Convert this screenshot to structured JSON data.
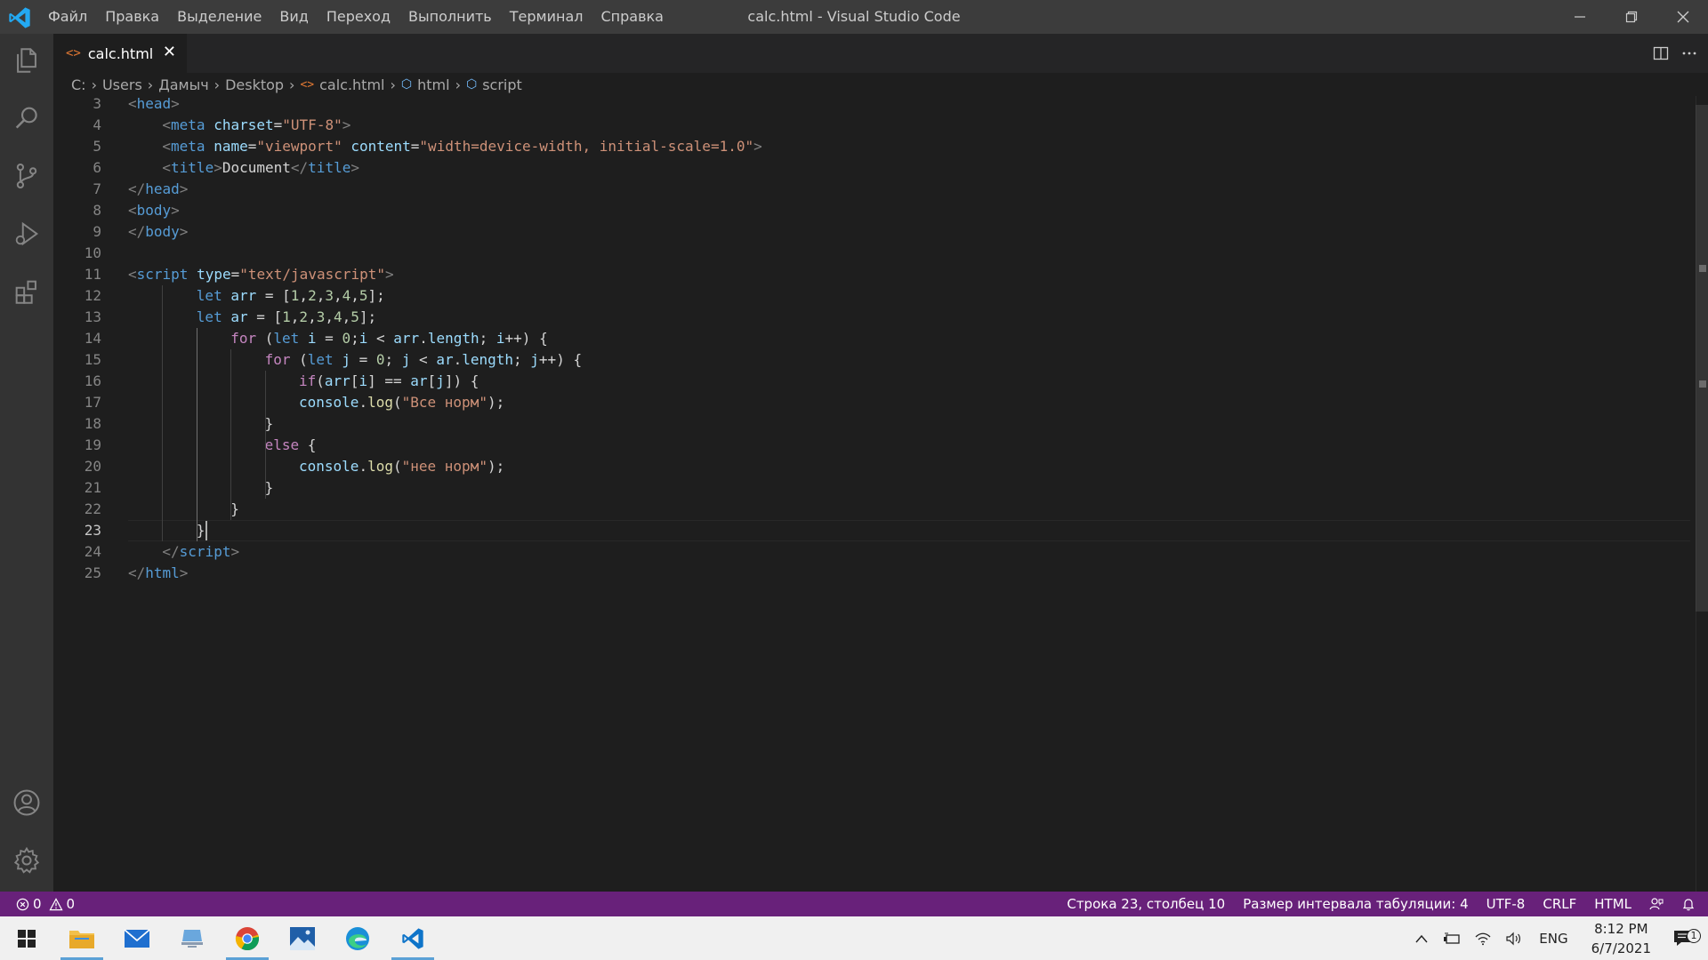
{
  "window": {
    "title": "calc.html - Visual Studio Code",
    "menu": [
      "Файл",
      "Правка",
      "Выделение",
      "Вид",
      "Переход",
      "Выполнить",
      "Терминал",
      "Справка"
    ]
  },
  "tab": {
    "icon": "<>",
    "label": "calc.html",
    "close": "✕"
  },
  "breadcrumb": {
    "parts": [
      "C:",
      "Users",
      "Дамыч",
      "Desktop"
    ],
    "file": "calc.html",
    "symbols": [
      "html",
      "script"
    ]
  },
  "editor": {
    "active_line": 23,
    "lines": [
      {
        "n": "3",
        "indent": 0,
        "tokens": [
          [
            "br",
            "<"
          ],
          [
            "tag",
            "head"
          ],
          [
            "br",
            ">"
          ]
        ]
      },
      {
        "n": "4",
        "indent": 1,
        "tokens": [
          [
            "br",
            "<"
          ],
          [
            "tag",
            "meta"
          ],
          [
            "txt",
            " "
          ],
          [
            "attr",
            "charset"
          ],
          [
            "txt",
            "="
          ],
          [
            "str",
            "\"UTF-8\""
          ],
          [
            "br",
            ">"
          ]
        ]
      },
      {
        "n": "5",
        "indent": 1,
        "tokens": [
          [
            "br",
            "<"
          ],
          [
            "tag",
            "meta"
          ],
          [
            "txt",
            " "
          ],
          [
            "attr",
            "name"
          ],
          [
            "txt",
            "="
          ],
          [
            "str",
            "\"viewport\""
          ],
          [
            "txt",
            " "
          ],
          [
            "attr",
            "content"
          ],
          [
            "txt",
            "="
          ],
          [
            "str",
            "\"width=device-width, initial-scale=1.0\""
          ],
          [
            "br",
            ">"
          ]
        ]
      },
      {
        "n": "6",
        "indent": 1,
        "tokens": [
          [
            "br",
            "<"
          ],
          [
            "tag",
            "title"
          ],
          [
            "br",
            ">"
          ],
          [
            "txt",
            "Document"
          ],
          [
            "br",
            "</"
          ],
          [
            "tag",
            "title"
          ],
          [
            "br",
            ">"
          ]
        ]
      },
      {
        "n": "7",
        "indent": 0,
        "tokens": [
          [
            "br",
            "</"
          ],
          [
            "tag",
            "head"
          ],
          [
            "br",
            ">"
          ]
        ]
      },
      {
        "n": "8",
        "indent": 0,
        "tokens": [
          [
            "br",
            "<"
          ],
          [
            "tag",
            "body"
          ],
          [
            "br",
            ">"
          ]
        ]
      },
      {
        "n": "9",
        "indent": 0,
        "tokens": [
          [
            "br",
            "</"
          ],
          [
            "tag",
            "body"
          ],
          [
            "br",
            ">"
          ]
        ]
      },
      {
        "n": "10",
        "indent": 0,
        "tokens": []
      },
      {
        "n": "11",
        "indent": 0,
        "tokens": [
          [
            "br",
            "<"
          ],
          [
            "tag",
            "script"
          ],
          [
            "txt",
            " "
          ],
          [
            "attr",
            "type"
          ],
          [
            "txt",
            "="
          ],
          [
            "str",
            "\"text/javascript\""
          ],
          [
            "br",
            ">"
          ]
        ]
      },
      {
        "n": "12",
        "indent": 2,
        "tokens": [
          [
            "kw",
            "let"
          ],
          [
            "txt",
            " "
          ],
          [
            "var",
            "arr"
          ],
          [
            "txt",
            " = ["
          ],
          [
            "num",
            "1"
          ],
          [
            "txt",
            ","
          ],
          [
            "num",
            "2"
          ],
          [
            "txt",
            ","
          ],
          [
            "num",
            "3"
          ],
          [
            "txt",
            ","
          ],
          [
            "num",
            "4"
          ],
          [
            "txt",
            ","
          ],
          [
            "num",
            "5"
          ],
          [
            "txt",
            "];"
          ]
        ]
      },
      {
        "n": "13",
        "indent": 2,
        "tokens": [
          [
            "kw",
            "let"
          ],
          [
            "txt",
            " "
          ],
          [
            "var",
            "ar"
          ],
          [
            "txt",
            " = ["
          ],
          [
            "num",
            "1"
          ],
          [
            "txt",
            ","
          ],
          [
            "num",
            "2"
          ],
          [
            "txt",
            ","
          ],
          [
            "num",
            "3"
          ],
          [
            "txt",
            ","
          ],
          [
            "num",
            "4"
          ],
          [
            "txt",
            ","
          ],
          [
            "num",
            "5"
          ],
          [
            "txt",
            "];"
          ]
        ]
      },
      {
        "n": "14",
        "indent": 3,
        "tokens": [
          [
            "ctl",
            "for"
          ],
          [
            "txt",
            " ("
          ],
          [
            "kw",
            "let"
          ],
          [
            "txt",
            " "
          ],
          [
            "var",
            "i"
          ],
          [
            "txt",
            " = "
          ],
          [
            "num",
            "0"
          ],
          [
            "txt",
            ";"
          ],
          [
            "var",
            "i"
          ],
          [
            "txt",
            " < "
          ],
          [
            "var",
            "arr"
          ],
          [
            "txt",
            "."
          ],
          [
            "var",
            "length"
          ],
          [
            "txt",
            "; "
          ],
          [
            "var",
            "i"
          ],
          [
            "txt",
            "++) {"
          ]
        ]
      },
      {
        "n": "15",
        "indent": 4,
        "tokens": [
          [
            "ctl",
            "for"
          ],
          [
            "txt",
            " ("
          ],
          [
            "kw",
            "let"
          ],
          [
            "txt",
            " "
          ],
          [
            "var",
            "j"
          ],
          [
            "txt",
            " = "
          ],
          [
            "num",
            "0"
          ],
          [
            "txt",
            "; "
          ],
          [
            "var",
            "j"
          ],
          [
            "txt",
            " < "
          ],
          [
            "var",
            "ar"
          ],
          [
            "txt",
            "."
          ],
          [
            "var",
            "length"
          ],
          [
            "txt",
            "; "
          ],
          [
            "var",
            "j"
          ],
          [
            "txt",
            "++) {"
          ]
        ]
      },
      {
        "n": "16",
        "indent": 5,
        "tokens": [
          [
            "ctl",
            "if"
          ],
          [
            "txt",
            "("
          ],
          [
            "var",
            "arr"
          ],
          [
            "txt",
            "["
          ],
          [
            "var",
            "i"
          ],
          [
            "txt",
            "] == "
          ],
          [
            "var",
            "ar"
          ],
          [
            "txt",
            "["
          ],
          [
            "var",
            "j"
          ],
          [
            "txt",
            "]) {"
          ]
        ]
      },
      {
        "n": "17",
        "indent": 5,
        "tokens": [
          [
            "var",
            "console"
          ],
          [
            "txt",
            "."
          ],
          [
            "fn",
            "log"
          ],
          [
            "txt",
            "("
          ],
          [
            "str",
            "\"Все норм\""
          ],
          [
            "txt",
            ");"
          ]
        ]
      },
      {
        "n": "18",
        "indent": 4,
        "tokens": [
          [
            "txt",
            "}"
          ]
        ]
      },
      {
        "n": "19",
        "indent": 4,
        "tokens": [
          [
            "ctl",
            "else"
          ],
          [
            "txt",
            " {"
          ]
        ]
      },
      {
        "n": "20",
        "indent": 5,
        "tokens": [
          [
            "var",
            "console"
          ],
          [
            "txt",
            "."
          ],
          [
            "fn",
            "log"
          ],
          [
            "txt",
            "("
          ],
          [
            "str",
            "\"нее норм\""
          ],
          [
            "txt",
            ");"
          ]
        ]
      },
      {
        "n": "21",
        "indent": 4,
        "tokens": [
          [
            "txt",
            "}"
          ]
        ]
      },
      {
        "n": "22",
        "indent": 3,
        "tokens": [
          [
            "txt",
            "}"
          ]
        ]
      },
      {
        "n": "23",
        "indent": 2,
        "tokens": [
          [
            "txt",
            "}"
          ]
        ]
      },
      {
        "n": "24",
        "indent": 1,
        "tokens": [
          [
            "br",
            "</"
          ],
          [
            "tag",
            "script"
          ],
          [
            "br",
            ">"
          ]
        ]
      },
      {
        "n": "25",
        "indent": 0,
        "tokens": [
          [
            "br",
            "</"
          ],
          [
            "tag",
            "html"
          ],
          [
            "br",
            ">"
          ]
        ]
      }
    ]
  },
  "status": {
    "errors": "0",
    "warnings": "0",
    "position": "Строка 23, столбец 10",
    "tab_size": "Размер интервала табуляции: 4",
    "encoding": "UTF-8",
    "eol": "CRLF",
    "language": "HTML"
  },
  "taskbar": {
    "lang": "ENG",
    "time": "8:12 PM",
    "date": "6/7/2021",
    "notifications": "1"
  },
  "colors": {
    "status_bar": "#68217a",
    "accent": "#007acc",
    "editor_bg": "#1e1e1e"
  }
}
